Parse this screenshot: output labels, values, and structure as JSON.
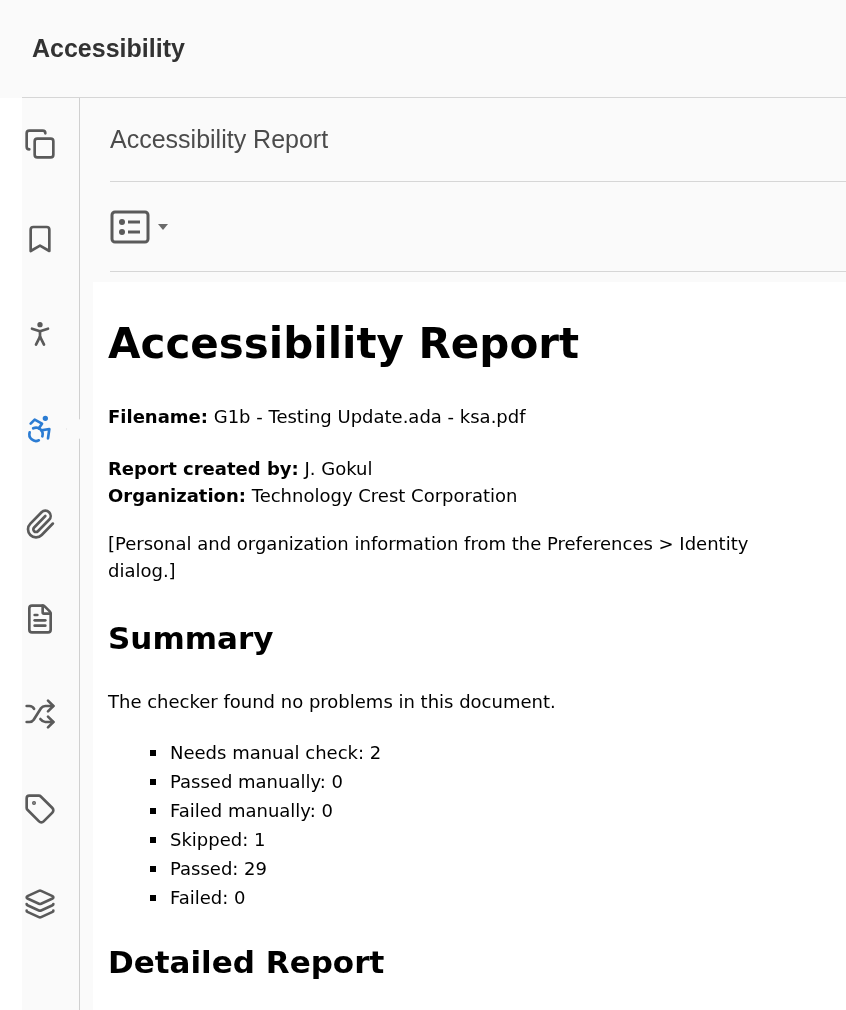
{
  "window": {
    "title": "Accessibility"
  },
  "sidebar": {
    "items": [
      {
        "kind": "pages",
        "selected": false
      },
      {
        "kind": "bookmarks",
        "selected": false
      },
      {
        "kind": "check",
        "selected": false
      },
      {
        "kind": "report",
        "selected": true
      },
      {
        "kind": "attachments",
        "selected": false
      },
      {
        "kind": "content",
        "selected": false
      },
      {
        "kind": "order",
        "selected": false
      },
      {
        "kind": "tags",
        "selected": false
      },
      {
        "kind": "layers",
        "selected": false
      }
    ]
  },
  "panel": {
    "title": "Accessibility Report"
  },
  "report": {
    "heading": "Accessibility Report",
    "filename": "**Filename:** G1b - Testing Update.ada - ksa.pdf",
    "created_by": "**Report created by:** J. Gokul",
    "organization": "**Organization:** Technology Crest Corporation",
    "note": "[Personal and organization information from the Preferences > Identity dialog.]",
    "summary_heading": "Summary",
    "summary_text": "The checker found no problems in this document.",
    "summary_items": [
      "Needs manual check: 2",
      "Passed manually: 0",
      "Failed manually: 0",
      "Skipped: 1",
      "Passed: 29",
      "Failed: 0"
    ],
    "detailed_heading": "Detailed Report"
  }
}
